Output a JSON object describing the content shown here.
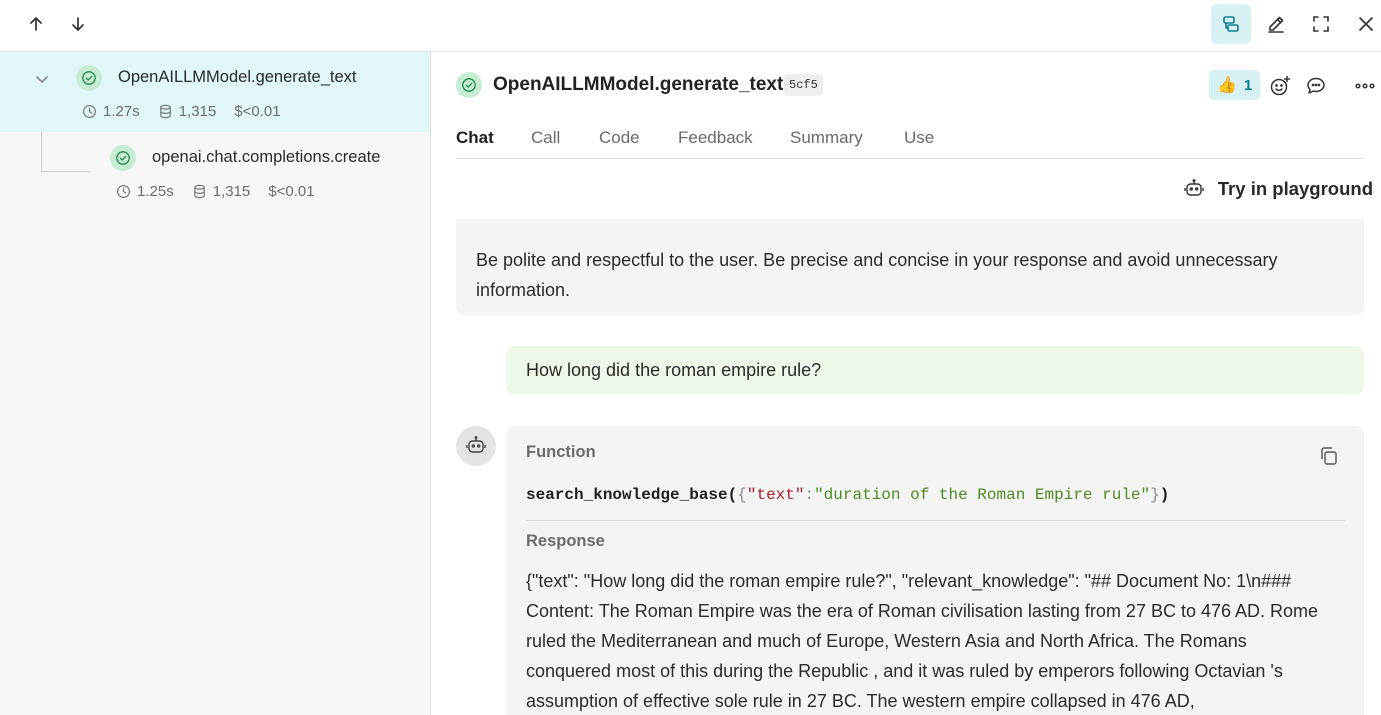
{
  "nav": {
    "up_icon": "arrow-up-icon",
    "down_icon": "arrow-down-icon"
  },
  "toolbar": {
    "icons": [
      "tree-view-icon",
      "pencil-icon",
      "fullscreen-icon",
      "close-icon"
    ],
    "active_color": "#d7f0f4"
  },
  "tree": {
    "root": {
      "title": "OpenAILLMModel.generate_text",
      "latency": "1.27s",
      "tokens": "1,315",
      "cost": "$<0.01"
    },
    "child": {
      "title": "openai.chat.completions.create",
      "latency": "1.25s",
      "tokens": "1,315",
      "cost": "$<0.01"
    }
  },
  "detail": {
    "title": "OpenAILLMModel.generate_text",
    "id_badge": "5cf5",
    "reaction": {
      "emoji": "👍",
      "count": "1"
    },
    "tabs": [
      "Chat",
      "Call",
      "Code",
      "Feedback",
      "Summary",
      "Use"
    ],
    "active_tab": "Chat",
    "playground_label": "Try in playground"
  },
  "chat": {
    "system_message": "Be polite and respectful to the user. Be precise and concise in your response and avoid unnecessary information.",
    "user_message": "How long did the roman empire rule?",
    "function": {
      "label": "Function",
      "name": "search_knowledge_base",
      "open_paren": "(",
      "open_brace": "{",
      "arg_key": "\"text\"",
      "colon": ":",
      "arg_value": "\"duration of the Roman Empire rule\"",
      "close_brace": "}",
      "close_paren": ")"
    },
    "response": {
      "label": "Response",
      "text": "{\"text\": \"How long did the roman empire rule?\", \"relevant_knowledge\": \"## Document No: 1\\n### Content: The Roman Empire was the era of Roman civilisation lasting from 27 BC to 476 AD. Rome ruled the Mediterranean and much of Europe, Western Asia and North Africa. The Romans conquered most of this during the Republic , and it was ruled by emperors following Octavian 's assumption of effective sole rule in 27 BC. The western empire collapsed in 476 AD,"
    }
  },
  "colors": {
    "accent": "#0b7e8e",
    "selected_row": "#e1f6f9",
    "success": "#c6ecd4",
    "user_bubble": "#eef8e8"
  }
}
